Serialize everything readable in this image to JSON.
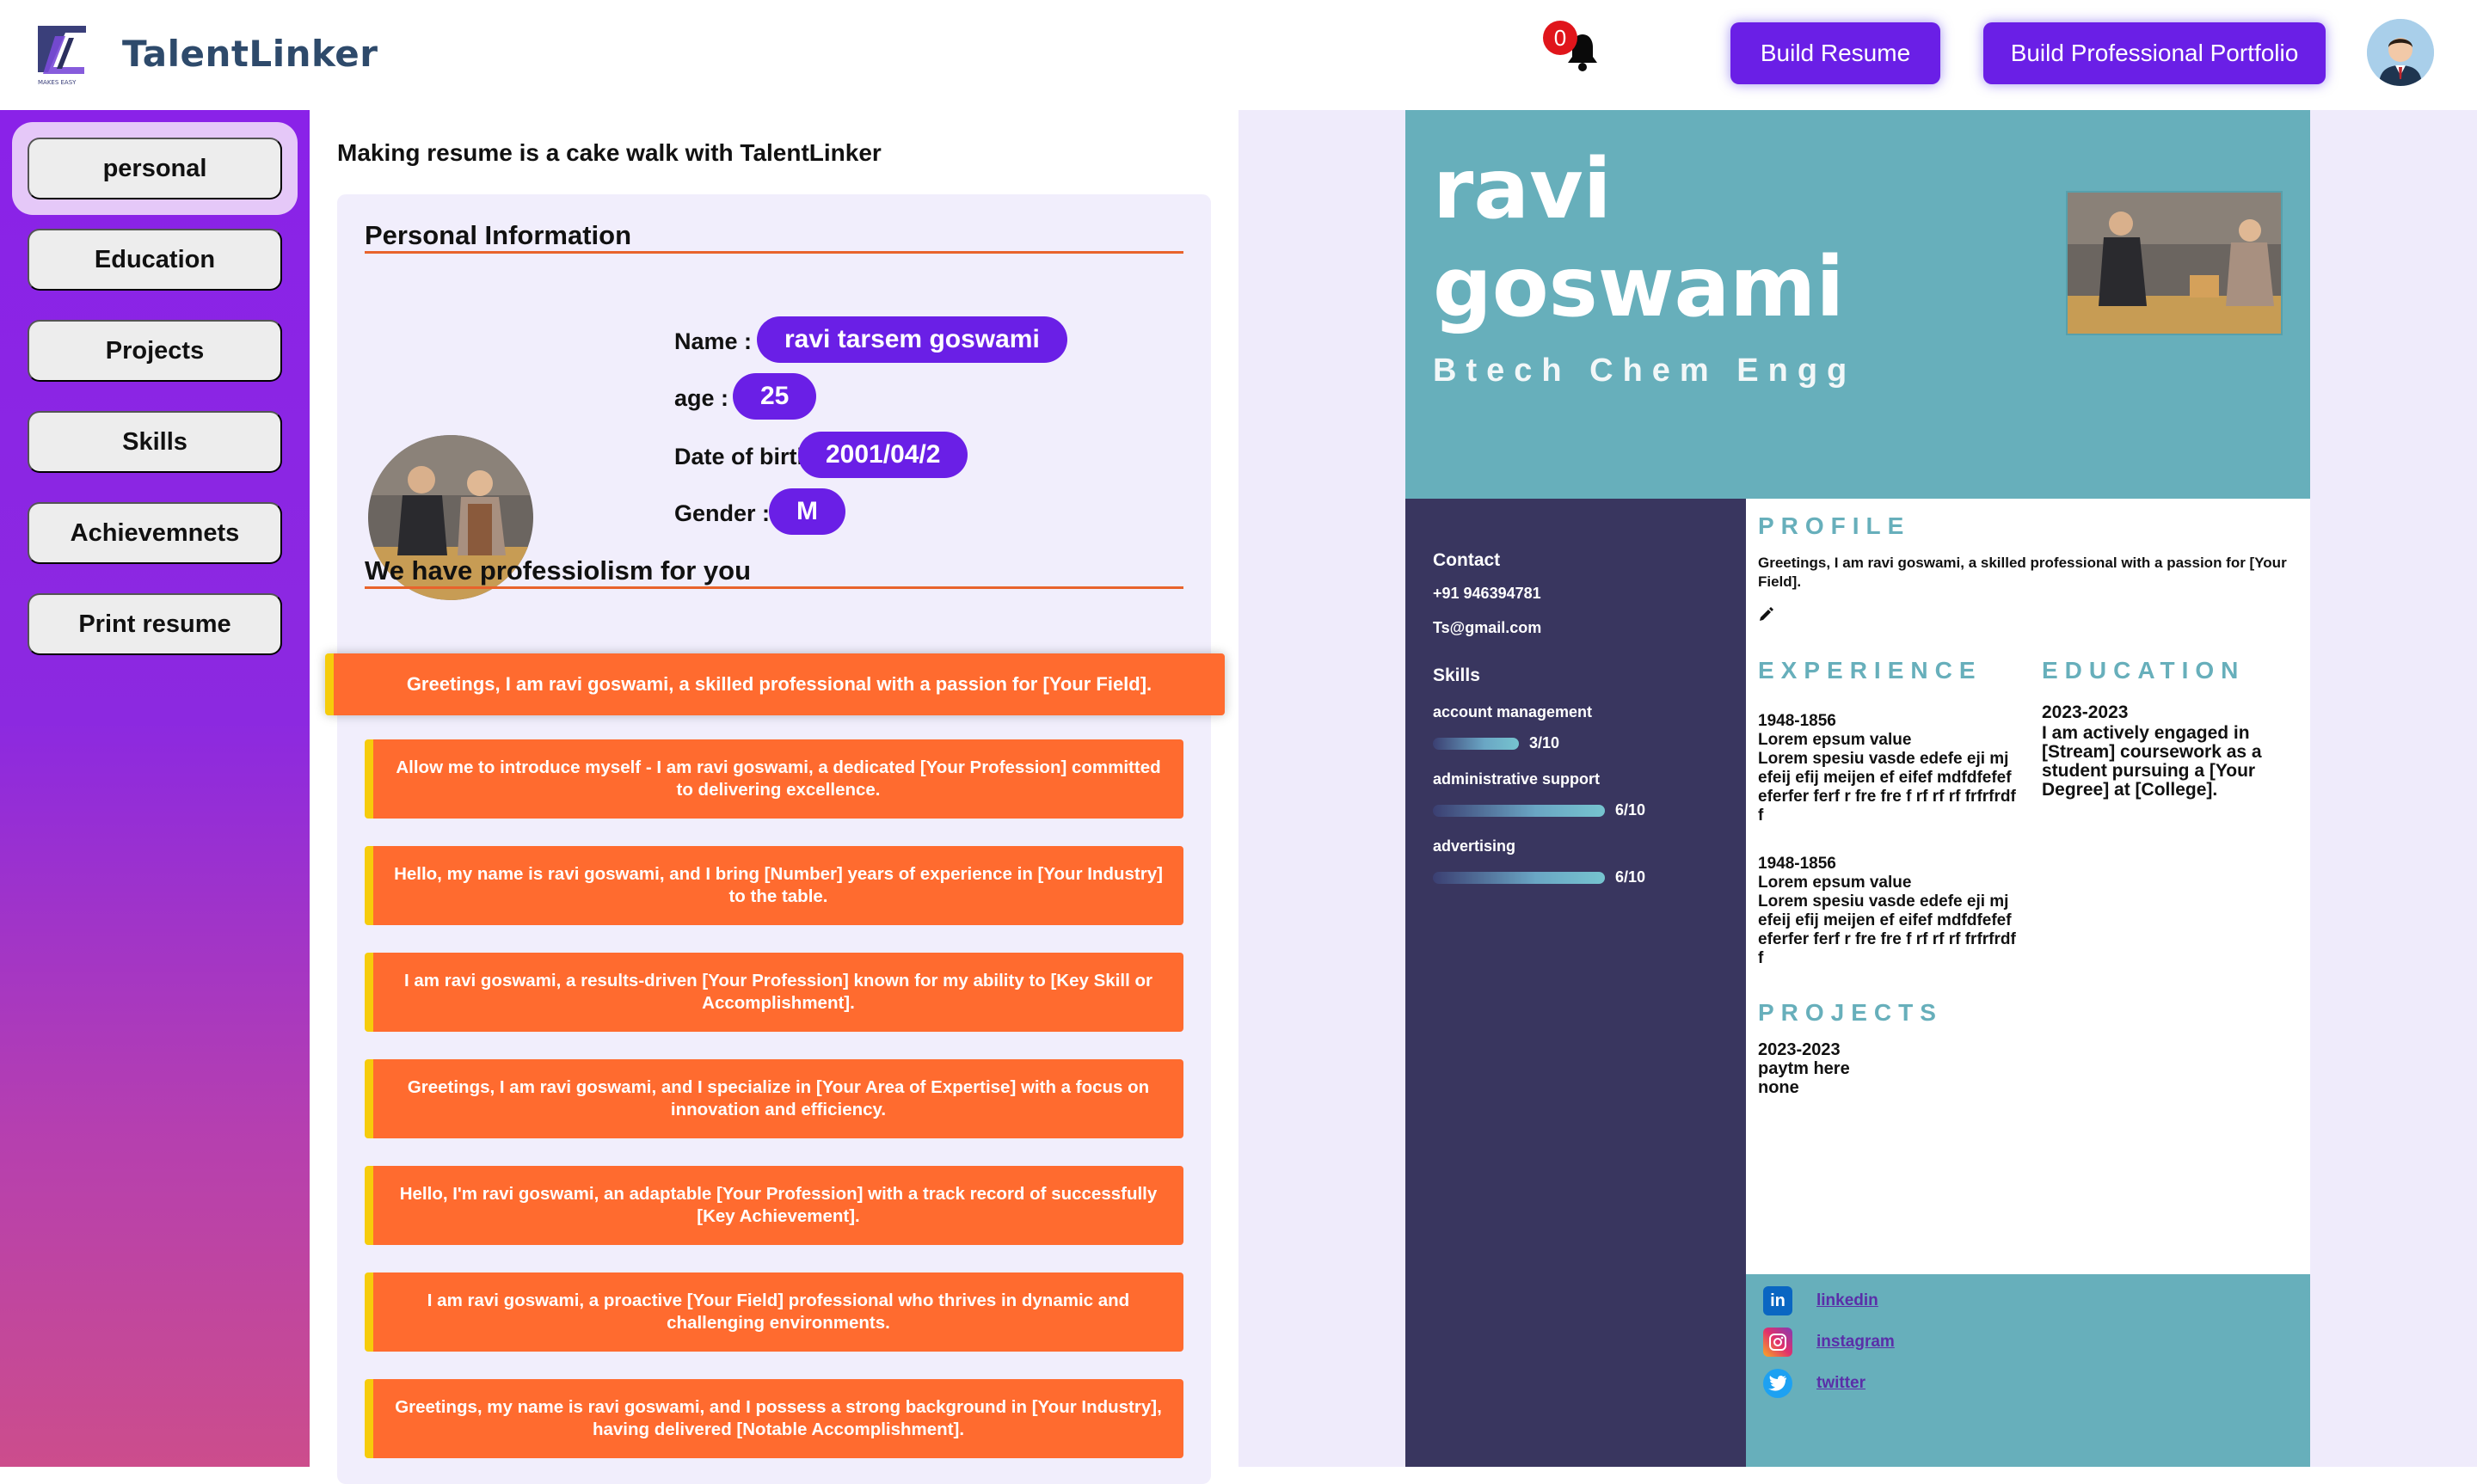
{
  "header": {
    "brand": "TalentLinker",
    "logo_tagline": "MAKES EASY",
    "notification_count": "0",
    "build_resume_label": "Build Resume",
    "build_portfolio_label": "Build Professional Portfolio"
  },
  "sidebar": {
    "items": [
      {
        "label": "personal",
        "active": true
      },
      {
        "label": "Education"
      },
      {
        "label": "Projects"
      },
      {
        "label": "Skills"
      },
      {
        "label": "Achievemnets"
      },
      {
        "label": "Print resume"
      }
    ]
  },
  "form": {
    "tagline": "Making resume is a cake walk with TalentLinker",
    "personal_title": "Personal Information",
    "name_label": "Name :",
    "name_value": "ravi tarsem goswami",
    "age_label": "age :",
    "age_value": "25",
    "dob_label": "Date of birth :",
    "dob_value": "2001/04/2",
    "gender_label": "Gender :",
    "gender_value": "M",
    "professionalism_title": "We have professiolism for you",
    "greetings": [
      "Greetings, I am ravi goswami, a skilled professional with a passion for [Your Field].",
      "Allow me to introduce myself - I am ravi goswami, a dedicated [Your Profession] committed to delivering excellence.",
      "Hello, my name is ravi goswami, and I bring [Number] years of experience in [Your Industry] to the table.",
      "I am ravi goswami, a results-driven [Your Profession] known for my ability to [Key Skill or Accomplishment].",
      "Greetings, I am ravi goswami, and I specialize in [Your Area of Expertise] with a focus on innovation and efficiency.",
      "Hello, I'm ravi goswami, an adaptable [Your Profession] with a track record of successfully [Key Achievement].",
      "I am ravi goswami, a proactive [Your Field] professional who thrives in dynamic and challenging environments.",
      "Greetings, my name is ravi goswami, and I possess a strong background in [Your Industry], having delivered [Notable Accomplishment]."
    ]
  },
  "resume": {
    "first_name": "ravi",
    "last_name": "goswami",
    "degree": "Btech Chem Engg",
    "contact_title": "Contact",
    "phone": "+91 946394781",
    "email": "Ts@gmail.com",
    "skills_title": "Skills",
    "skills": [
      {
        "name": "account management",
        "score": "3/10",
        "level": 0.3
      },
      {
        "name": "administrative support",
        "score": "6/10",
        "level": 0.6
      },
      {
        "name": "advertising",
        "score": "6/10",
        "level": 0.6
      }
    ],
    "profile_title": "PROFILE",
    "profile_text": "Greetings, I am ravi goswami, a skilled professional with a passion for [Your Field].",
    "experience_title": "EXPERIENCE",
    "experience": [
      {
        "years": "1948-1856",
        "title": "Lorem epsum value",
        "desc": "Lorem spesiu vasde edefe eji mj efeij efij meijen ef eifef mdfdfefef eferfer ferf r fre fre f rf rf rf frfrfrdf f"
      },
      {
        "years": "1948-1856",
        "title": "Lorem epsum value",
        "desc": "Lorem spesiu vasde edefe eji mj efeij efij meijen ef eifef mdfdfefef eferfer ferf r fre fre f rf rf rf frfrfrdf f"
      }
    ],
    "education_title": "EDUCATION",
    "education_years": "2023-2023",
    "education_text": "I am actively engaged in [Stream] coursework as a student pursuing a [Your Degree] at [College].",
    "projects_title": "PROJECTS",
    "project_years": "2023-2023",
    "project_name": "paytm here",
    "project_desc": "none",
    "socials": [
      {
        "label": "linkedin",
        "icon": "linkedin-icon"
      },
      {
        "label": "instagram",
        "icon": "instagram-icon"
      },
      {
        "label": "twitter",
        "icon": "twitter-icon"
      }
    ]
  }
}
